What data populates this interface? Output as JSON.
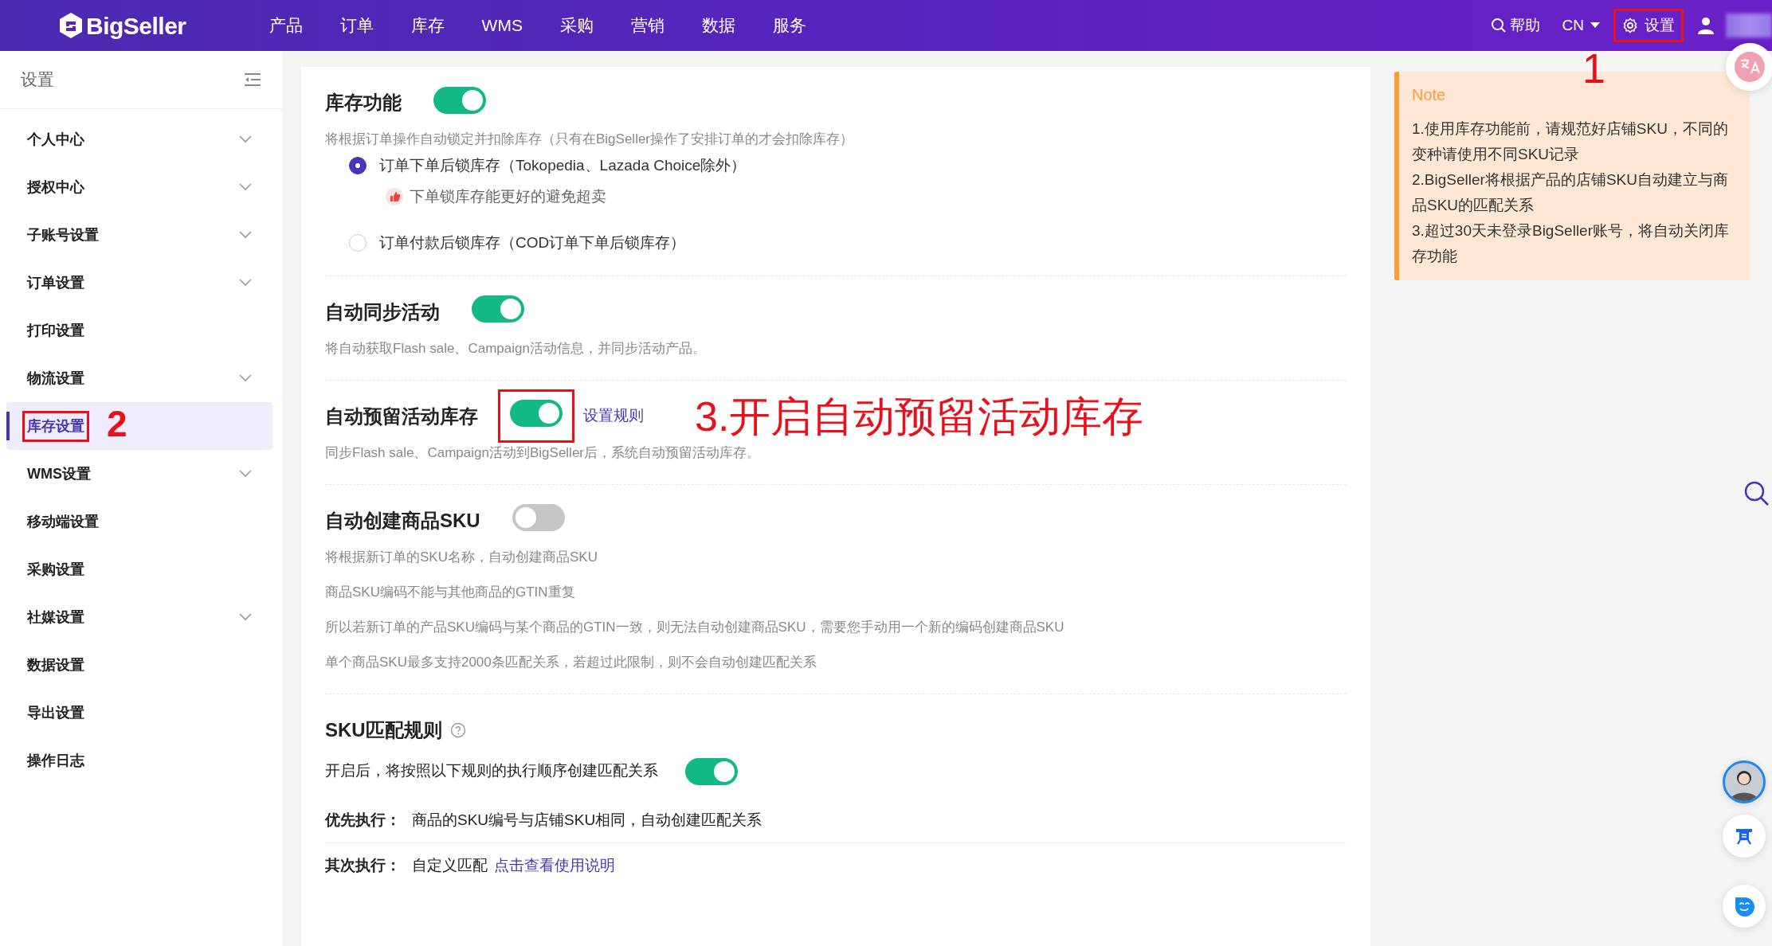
{
  "topbar": {
    "logo": "BigSeller",
    "nav": [
      "产品",
      "订单",
      "库存",
      "WMS",
      "采购",
      "营销",
      "数据",
      "服务"
    ],
    "help": "帮助",
    "language": "CN",
    "settings": {
      "label": "设置",
      "callout": "1"
    }
  },
  "sidebar": {
    "title": "设置",
    "items": [
      {
        "label": "个人中心",
        "expandable": true,
        "selected": false
      },
      {
        "label": "授权中心",
        "expandable": true,
        "selected": false
      },
      {
        "label": "子账号设置",
        "expandable": true,
        "selected": false
      },
      {
        "label": "订单设置",
        "expandable": true,
        "selected": false
      },
      {
        "label": "打印设置",
        "expandable": false,
        "selected": false
      },
      {
        "label": "物流设置",
        "expandable": true,
        "selected": false
      },
      {
        "label": "库存设置",
        "expandable": false,
        "selected": true,
        "callout": "2"
      },
      {
        "label": "WMS设置",
        "expandable": true,
        "selected": false
      },
      {
        "label": "移动端设置",
        "expandable": false,
        "selected": false
      },
      {
        "label": "采购设置",
        "expandable": false,
        "selected": false
      },
      {
        "label": "社媒设置",
        "expandable": true,
        "selected": false
      },
      {
        "label": "数据设置",
        "expandable": false,
        "selected": false
      },
      {
        "label": "导出设置",
        "expandable": false,
        "selected": false
      },
      {
        "label": "操作日志",
        "expandable": false,
        "selected": false
      }
    ]
  },
  "sections": [
    {
      "kind": "toggle",
      "title": "库存功能",
      "on": true,
      "lines": [
        "将根据订单操作自动锁定并扣除库存（只有在BigSeller操作了安排订单的才会扣除库存）"
      ],
      "options": [
        {
          "label": "订单下单后锁库存（Tokopedia、Lazada Choice除外）",
          "selected": true,
          "tip": "下单锁库存能更好的避免超卖"
        },
        {
          "label": "订单付款后锁库存（COD订单下单后锁库存）",
          "selected": false
        }
      ]
    },
    {
      "kind": "toggle",
      "title": "自动同步活动",
      "on": true,
      "lines": [
        "将自动获取Flash sale、Campaign活动信息，并同步活动产品。"
      ]
    },
    {
      "kind": "toggle",
      "title": "自动预留活动库存",
      "on": true,
      "link": "设置规则",
      "callout": "3.开启自动预留活动库存",
      "lines": [
        "同步Flash sale、Campaign活动到BigSeller后，系统自动预留活动库存。"
      ]
    },
    {
      "kind": "toggle",
      "title": "自动创建商品SKU",
      "on": false,
      "lines": [
        "将根据新订单的SKU名称，自动创建商品SKU",
        "商品SKU编码不能与其他商品的GTIN重复",
        "所以若新订单的产品SKU编码与某个商品的GTIN一致，则无法自动创建商品SKU，需要您手动用一个新的编码创建商品SKU",
        "单个商品SKU最多支持2000条匹配关系，若超过此限制，则不会自动创建匹配关系"
      ]
    },
    {
      "kind": "rules",
      "title": "SKU匹配规则",
      "switch_label": "开启后，将按照以下规则的执行顺序创建匹配关系",
      "on": true,
      "rules": [
        {
          "label": "优先执行：",
          "text": "商品的SKU编号与店铺SKU相同，自动创建匹配关系"
        },
        {
          "label": "其次执行：",
          "text": "自定义匹配",
          "link": "点击查看使用说明"
        }
      ]
    }
  ],
  "note": {
    "title": "Note",
    "lines": [
      "1.使用库存功能前，请规范好店铺SKU，不同的变种请使用不同SKU记录",
      "2.BigSeller将根据产品的店铺SKU自动建立与商品SKU的匹配关系",
      "3.超过30天未登录BigSeller账号，将自动关闭库存功能"
    ]
  }
}
